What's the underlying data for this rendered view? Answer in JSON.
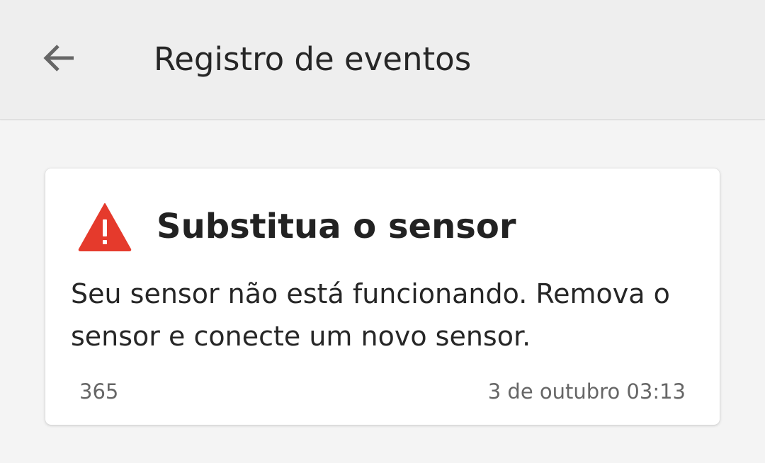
{
  "header": {
    "title": "Registro de eventos",
    "back_icon": "arrow-left-icon"
  },
  "event": {
    "icon": "warning-triangle-icon",
    "icon_color": "#e53a2c",
    "title": "Substitua o sensor",
    "message": "Seu sensor não está funcionando. Remova o sensor e conecte um novo sensor.",
    "code": "365",
    "timestamp": "3 de outubro 03:13"
  }
}
